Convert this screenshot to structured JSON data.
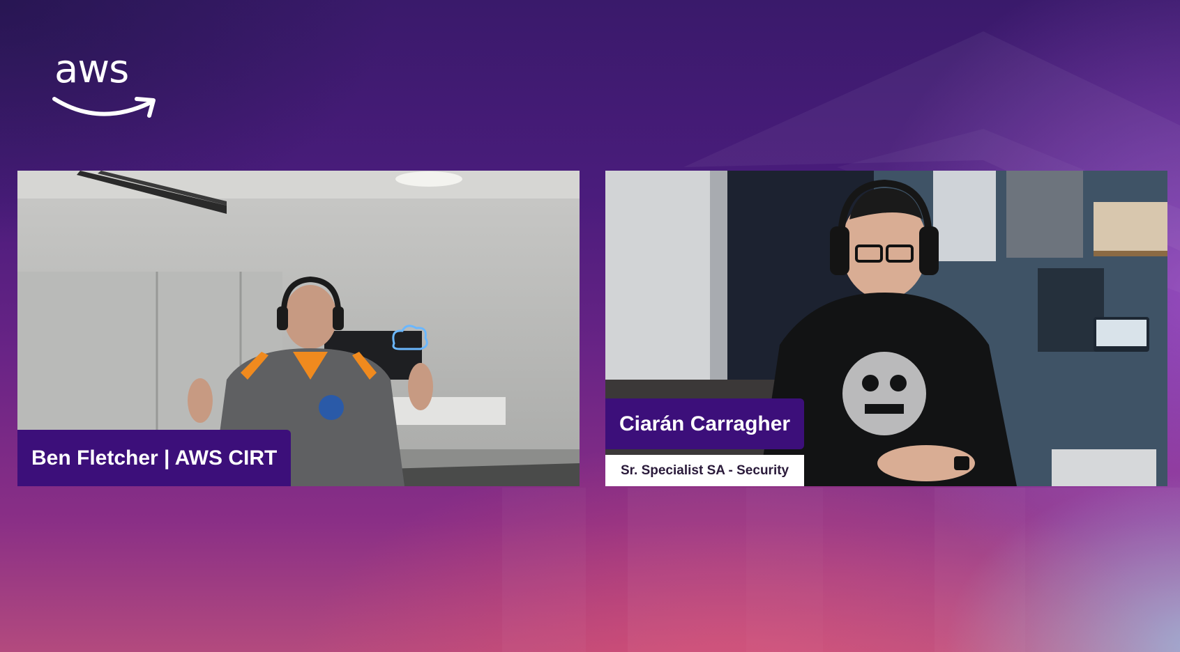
{
  "branding": {
    "logo_text": "aws",
    "logo_icon": "aws-smile-arrow-icon"
  },
  "participants": [
    {
      "name_label": "Ben Fletcher | AWS CIRT",
      "title_label": ""
    },
    {
      "name_label": "Ciarán Carragher",
      "title_label": "Sr. Specialist SA - Security"
    }
  ],
  "colors": {
    "name_bar": "#3c0f7a",
    "title_bar": "#ffffff",
    "background_top": "#3a1a6b",
    "background_bottom": "#b34a7e"
  }
}
